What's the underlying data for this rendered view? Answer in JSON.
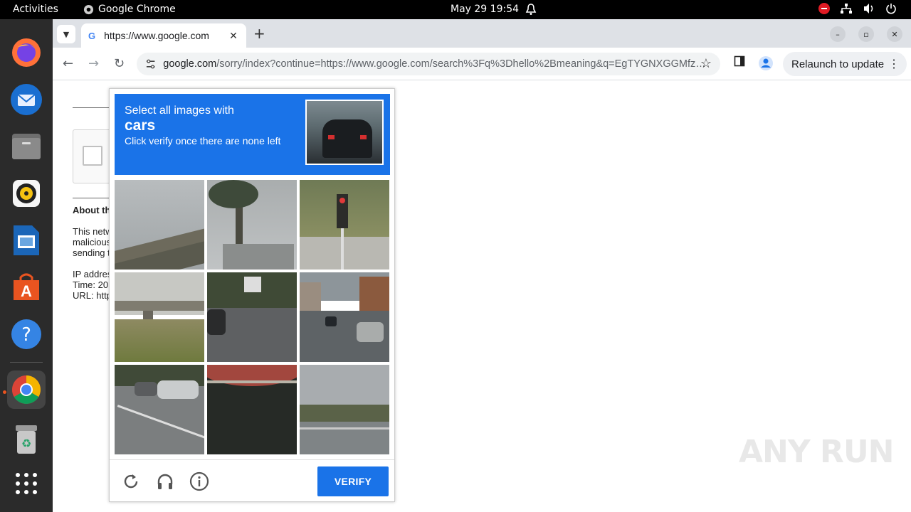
{
  "topbar": {
    "activities": "Activities",
    "app_name": "Google Chrome",
    "clock": "May 29  19:54"
  },
  "browser": {
    "tab_title": "https://www.google.com",
    "address_domain": "google.com",
    "address_rest": "/sorry/index?continue=https://www.google.com/search%3Fq%3Dhello%2Bmeaning&q=EgTYGNXGGMfz…",
    "relaunch_label": "Relaunch to update"
  },
  "page": {
    "about_heading": "About th",
    "para1": [
      "This netw",
      "malicious",
      "sending t"
    ],
    "para2": [
      "IP addres",
      "Time: 20",
      "URL: http"
    ]
  },
  "captcha": {
    "line1": "Select all images with",
    "keyword": "cars",
    "line3": "Click verify once there are none left",
    "verify_label": "VERIFY",
    "tiles": [
      {
        "name": "overpass"
      },
      {
        "name": "palm-tree"
      },
      {
        "name": "traffic-light"
      },
      {
        "name": "bridge"
      },
      {
        "name": "street-car"
      },
      {
        "name": "street-cars"
      },
      {
        "name": "parked-cars"
      },
      {
        "name": "awning"
      },
      {
        "name": "highway"
      }
    ]
  },
  "watermark": "ANY RUN"
}
